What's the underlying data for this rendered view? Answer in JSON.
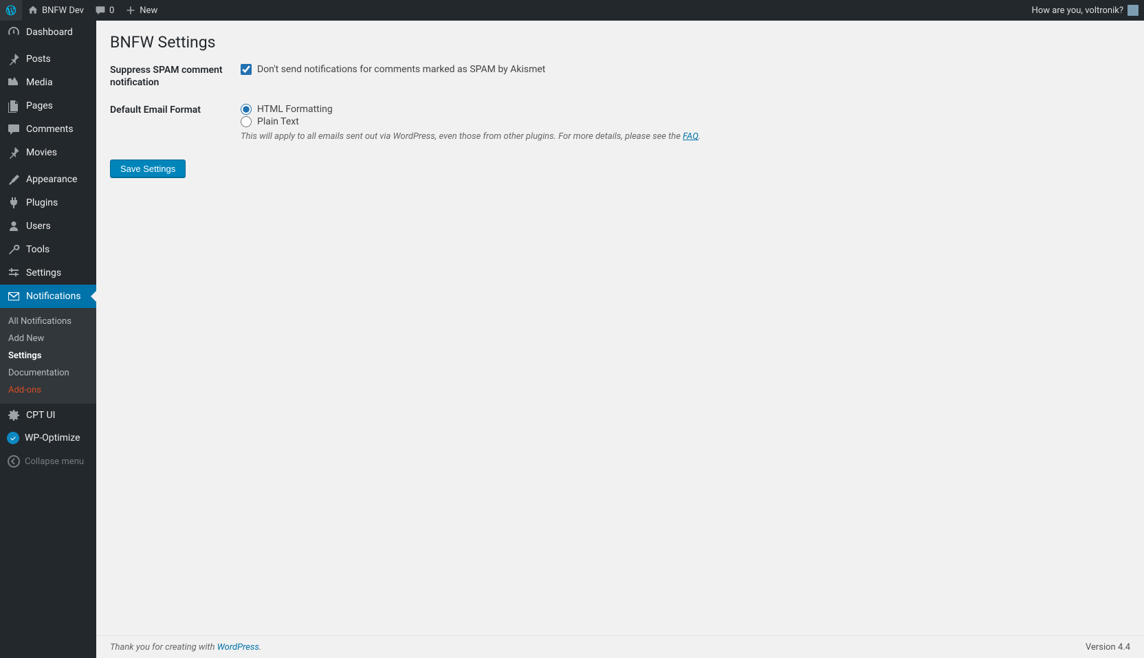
{
  "adminbar": {
    "site_name": "BNFW Dev",
    "comment_count": "0",
    "new_label": "New",
    "howdy": "How are you, voltronik?"
  },
  "sidebar": {
    "items": [
      {
        "label": "Dashboard",
        "icon": "dashboard"
      },
      {
        "label": "Posts",
        "icon": "pin"
      },
      {
        "label": "Media",
        "icon": "media"
      },
      {
        "label": "Pages",
        "icon": "pages"
      },
      {
        "label": "Comments",
        "icon": "comment"
      },
      {
        "label": "Movies",
        "icon": "pin"
      },
      {
        "label": "Appearance",
        "icon": "brush"
      },
      {
        "label": "Plugins",
        "icon": "plug"
      },
      {
        "label": "Users",
        "icon": "user"
      },
      {
        "label": "Tools",
        "icon": "wrench"
      },
      {
        "label": "Settings",
        "icon": "sliders"
      },
      {
        "label": "Notifications",
        "icon": "mail"
      },
      {
        "label": "CPT UI",
        "icon": "gear"
      },
      {
        "label": "WP-Optimize",
        "icon": "check"
      }
    ],
    "submenu": [
      {
        "label": "All Notifications"
      },
      {
        "label": "Add New"
      },
      {
        "label": "Settings"
      },
      {
        "label": "Documentation"
      },
      {
        "label": "Add-ons"
      }
    ],
    "collapse_label": "Collapse menu"
  },
  "page": {
    "title": "BNFW Settings",
    "rows": {
      "spam": {
        "heading": "Suppress SPAM comment notification",
        "checkbox_label": "Don't send notifications for comments marked as SPAM by Akismet"
      },
      "format": {
        "heading": "Default Email Format",
        "option_html": "HTML Formatting",
        "option_plain": "Plain Text",
        "description_pre": "This will apply to all emails sent out via WordPress, even those from other plugins. For more details, please see the ",
        "description_link": "FAQ",
        "description_post": "."
      }
    },
    "save_button": "Save Settings"
  },
  "footer": {
    "thank_pre": "Thank you for creating with ",
    "thank_link": "WordPress",
    "thank_post": ".",
    "version": "Version 4.4"
  }
}
